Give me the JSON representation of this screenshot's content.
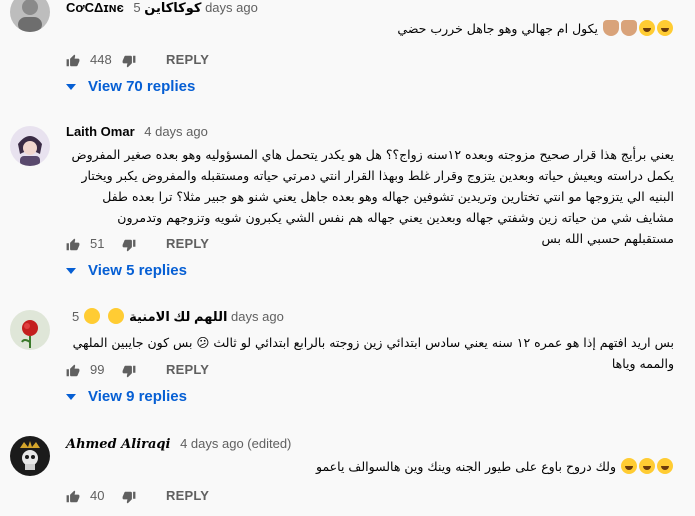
{
  "comments": [
    {
      "author": "CơCΔɪɴє كوكاكاين",
      "time": "5 days ago",
      "text": "يكول ام جهالي وهو جاهل خررب حضي",
      "likes": "448",
      "reply_label": "REPLY",
      "view_replies": "View 70 replies"
    },
    {
      "author": "Laith Omar",
      "time": "4 days ago",
      "text": "يعني برأيج هذا قرار صحيح مزوجته وبعده ١٢سنه زواج؟؟ هل هو يكدر يتحمل هاي المسؤوليه وهو بعده صغير المفروض يكمل دراسته ويعيش حياته وبعدين يتزوج وقرار غلط وبهذا القرار انتي دمرتي حياته ومستقبله والمفروض يكبر ويختار البنيه الي يتزوجها مو انتي تختارين وتريدين تشوفين جهاله وهو بعده جاهل يعني شنو هو جبير مثلا؟ ترا بعده طفل مشايف شي من حياته زين وشفتي جهاله وبعدين يعني جهاله هم نفس الشي يكبرون شويه وتزوجهم وتدمرون مستقبلهم حسبي الله بس",
      "likes": "51",
      "reply_label": "REPLY",
      "view_replies": "View 5 replies"
    },
    {
      "author": "اللهم لك الامنية",
      "time": "5 days ago",
      "text": "بس اريد افتهم إذا هو عمره ١٢ سنه يعني سادس ابتدائي زين زوجته بالرابع ابتدائي لو ثالث 😕 بس كون جايبين الملهي والممه وياها",
      "likes": "99",
      "reply_label": "REPLY",
      "view_replies": "View 9 replies"
    },
    {
      "author": "Ahmed Aliraqi",
      "time": "4 days ago (edited)",
      "text": "ولك دروح باوع على طيور الجنه وينك وين هالسوالف ياعمو",
      "likes": "40",
      "reply_label": "REPLY"
    }
  ]
}
